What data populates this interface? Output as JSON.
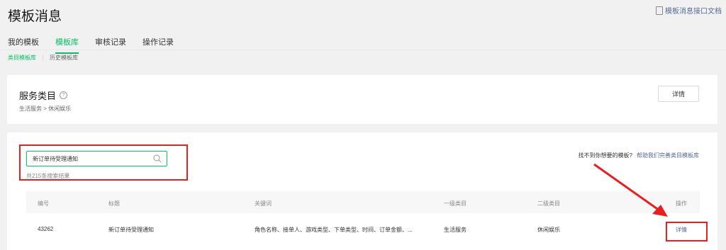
{
  "page": {
    "title": "模板消息",
    "doc_link": "模板消息接口文档"
  },
  "tabs": [
    "我的模板",
    "模板库",
    "审核记录",
    "操作记录"
  ],
  "subtabs": [
    "类目模板库",
    "历史模板库"
  ],
  "service": {
    "title": "服务类目",
    "path": "生活服务 > 休闲娱乐",
    "detail_button": "详情"
  },
  "search": {
    "value": "新订单待受理通知",
    "result_count": "共215条搜索结果"
  },
  "missing": {
    "text": "找不到你想要的模板?",
    "link": "帮助我们完善类目模板库"
  },
  "table": {
    "columns": [
      "编号",
      "标题",
      "关键词",
      "一级类目",
      "二级类目",
      "操作"
    ],
    "rows": [
      {
        "id": "43262",
        "title": "新订单待受理通知",
        "keywords": "角色名称、接单人、游戏类型、下单类型、时间、订单金额、...",
        "category1": "生活服务",
        "category2": "休闲娱乐",
        "action": "详情"
      }
    ]
  },
  "colors": {
    "accent": "#07c160",
    "link": "#576b95",
    "annotation": "#e62020"
  }
}
